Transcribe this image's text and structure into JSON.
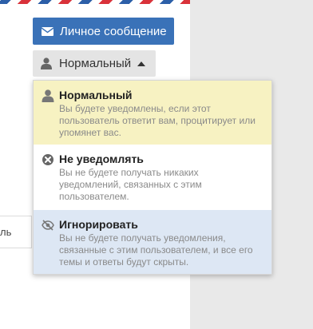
{
  "colors": {
    "primary": "#3a72b8",
    "selected_bg": "#f7f2c2",
    "ignore_bg": "#dde7f4"
  },
  "header": {
    "message_button_label": "Личное сообщение",
    "message_icon": "envelope-icon",
    "notification_button_label": "Нормальный",
    "notification_icon": "user-icon",
    "caret_icon": "caret-up-icon"
  },
  "left_row": {
    "text": "ль"
  },
  "menu": {
    "items": [
      {
        "title": "Нормальный",
        "description": "Вы будете уведомлены, если этот пользователь ответит вам, процитирует или упомянет вас.",
        "icon": "user-icon",
        "selected": true
      },
      {
        "title": "Не уведомлять",
        "description": "Вы не будете получать никаких уведомлений, связанных с этим пользователем.",
        "icon": "circle-x-icon",
        "selected": false
      },
      {
        "title": "Игнорировать",
        "description": "Вы не будете получать уведомления, связанные с этим пользователем, и все его темы и ответы будут скрыты.",
        "icon": "eye-slash-icon",
        "selected": false
      }
    ]
  }
}
